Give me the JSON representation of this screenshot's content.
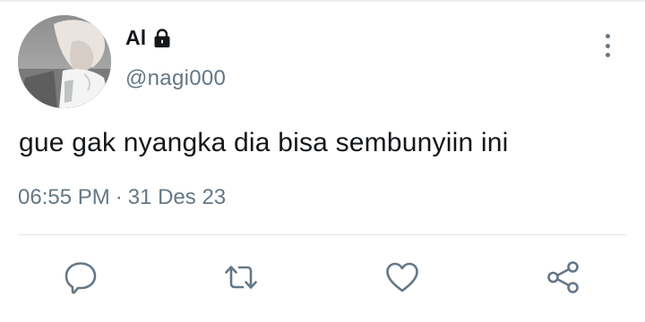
{
  "user": {
    "display_name": "Al",
    "handle": "@nagi000",
    "protected": true
  },
  "tweet": {
    "text": "gue gak nyangka dia bisa sembunyiin ini",
    "time": "06:55 PM",
    "separator": "·",
    "date": "31 Des 23"
  },
  "icons": {
    "lock": "lock-icon",
    "more": "more-vertical-icon",
    "reply": "reply-icon",
    "retweet": "retweet-icon",
    "like": "heart-icon",
    "share": "share-icon"
  },
  "colors": {
    "text": "#14171a",
    "secondary": "#657786",
    "divider": "#e1e8ed"
  }
}
